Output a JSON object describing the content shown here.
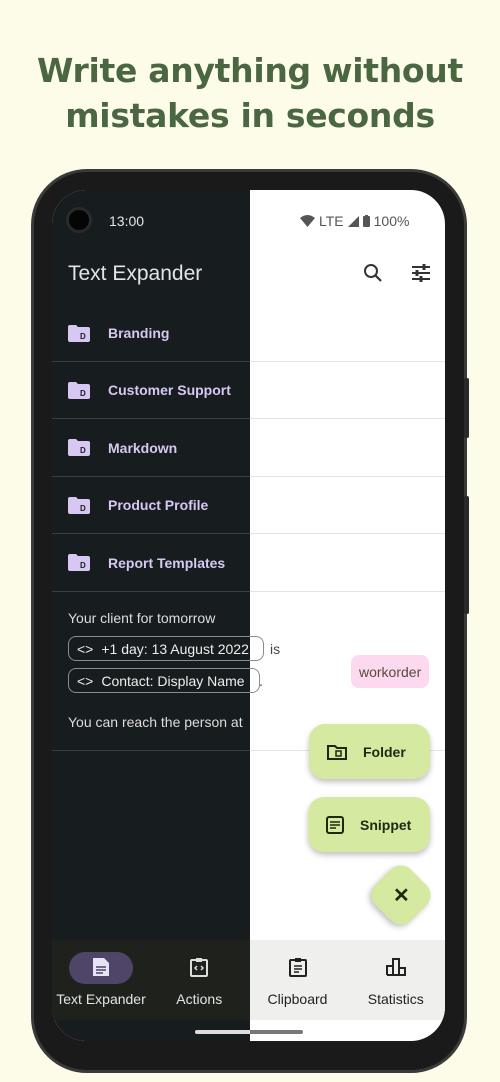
{
  "headline": [
    "Write anything without",
    "mistakes in seconds"
  ],
  "status": {
    "time": "13:00",
    "network": "LTE",
    "battery": "100%"
  },
  "app_bar": {
    "title": "Text Expander",
    "icons": [
      "search-icon",
      "tune-icon"
    ]
  },
  "folders": [
    {
      "label": "Branding"
    },
    {
      "label": "Customer Support"
    },
    {
      "label": "Markdown"
    },
    {
      "label": "Product Profile"
    },
    {
      "label": "Report Templates"
    }
  ],
  "snippet": {
    "line1": "Your client for tomorrow",
    "chip1": "+1 day: 13 August 2022",
    "after_chip1": "is",
    "chip2": "Contact: Display Name",
    "after_chip2": ".",
    "line3": "You can reach the person at",
    "tag": "workorder"
  },
  "fabs": {
    "folder": "Folder",
    "snippet": "Snippet",
    "close_icon": "close-icon"
  },
  "nav": [
    {
      "label": "Text Expander",
      "icon": "document-icon",
      "active": true
    },
    {
      "label": "Actions",
      "icon": "code-clipboard-icon"
    },
    {
      "label": "Clipboard",
      "icon": "clipboard-icon"
    },
    {
      "label": "Statistics",
      "icon": "bar-chart-icon"
    }
  ],
  "colors": {
    "accent": "#d6e9a1",
    "headline": "#4b6741",
    "folder": "#d6c8f2",
    "tag_bg": "#fcd9ef",
    "nav_active": "#4e4569"
  }
}
